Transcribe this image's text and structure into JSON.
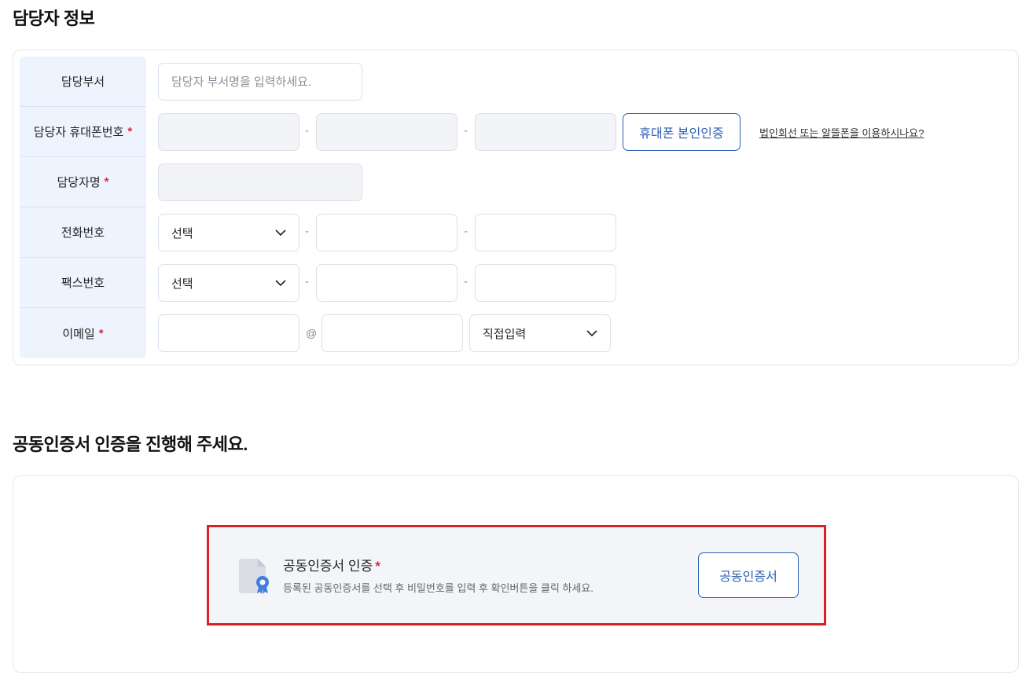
{
  "contact_section": {
    "title": "담당자 정보",
    "rows": [
      {
        "label": "담당부서",
        "required": false
      },
      {
        "label": "담당자 휴대폰번호",
        "required": true
      },
      {
        "label": "담당자명",
        "required": true
      },
      {
        "label": "전화번호",
        "required": false
      },
      {
        "label": "팩스번호",
        "required": false
      },
      {
        "label": "이메일",
        "required": true
      }
    ],
    "required_mark": "*",
    "department": {
      "placeholder": "담당자 부서명을 입력하세요.",
      "value": ""
    },
    "mobile": {
      "part1": "",
      "part2": "",
      "part3": "",
      "verify_button": "휴대폰 본인인증",
      "alt_link": "법인회선 또는 알뜰폰을 이용하시나요?"
    },
    "name": {
      "value": ""
    },
    "phone": {
      "area_select": "선택",
      "part2": "",
      "part3": ""
    },
    "fax": {
      "area_select": "선택",
      "part2": "",
      "part3": ""
    },
    "email": {
      "local": "",
      "at": "@",
      "domain": "",
      "domain_select": "직접입력"
    },
    "separator": "-"
  },
  "cert_section": {
    "title": "공동인증서 인증을 진행해 주세요.",
    "box_title": "공동인증서 인증",
    "required_mark": "*",
    "description": "등록된 공동인증서를 선택 후 비밀번호를 입력 후 확인버튼을 클릭 하세요.",
    "button": "공동인증서",
    "icon": "certificate-document-icon"
  },
  "colors": {
    "accent": "#2b5fb3",
    "required": "#e0263a",
    "label_bg": "#edf4fd",
    "highlight_border": "#dd1f26"
  }
}
